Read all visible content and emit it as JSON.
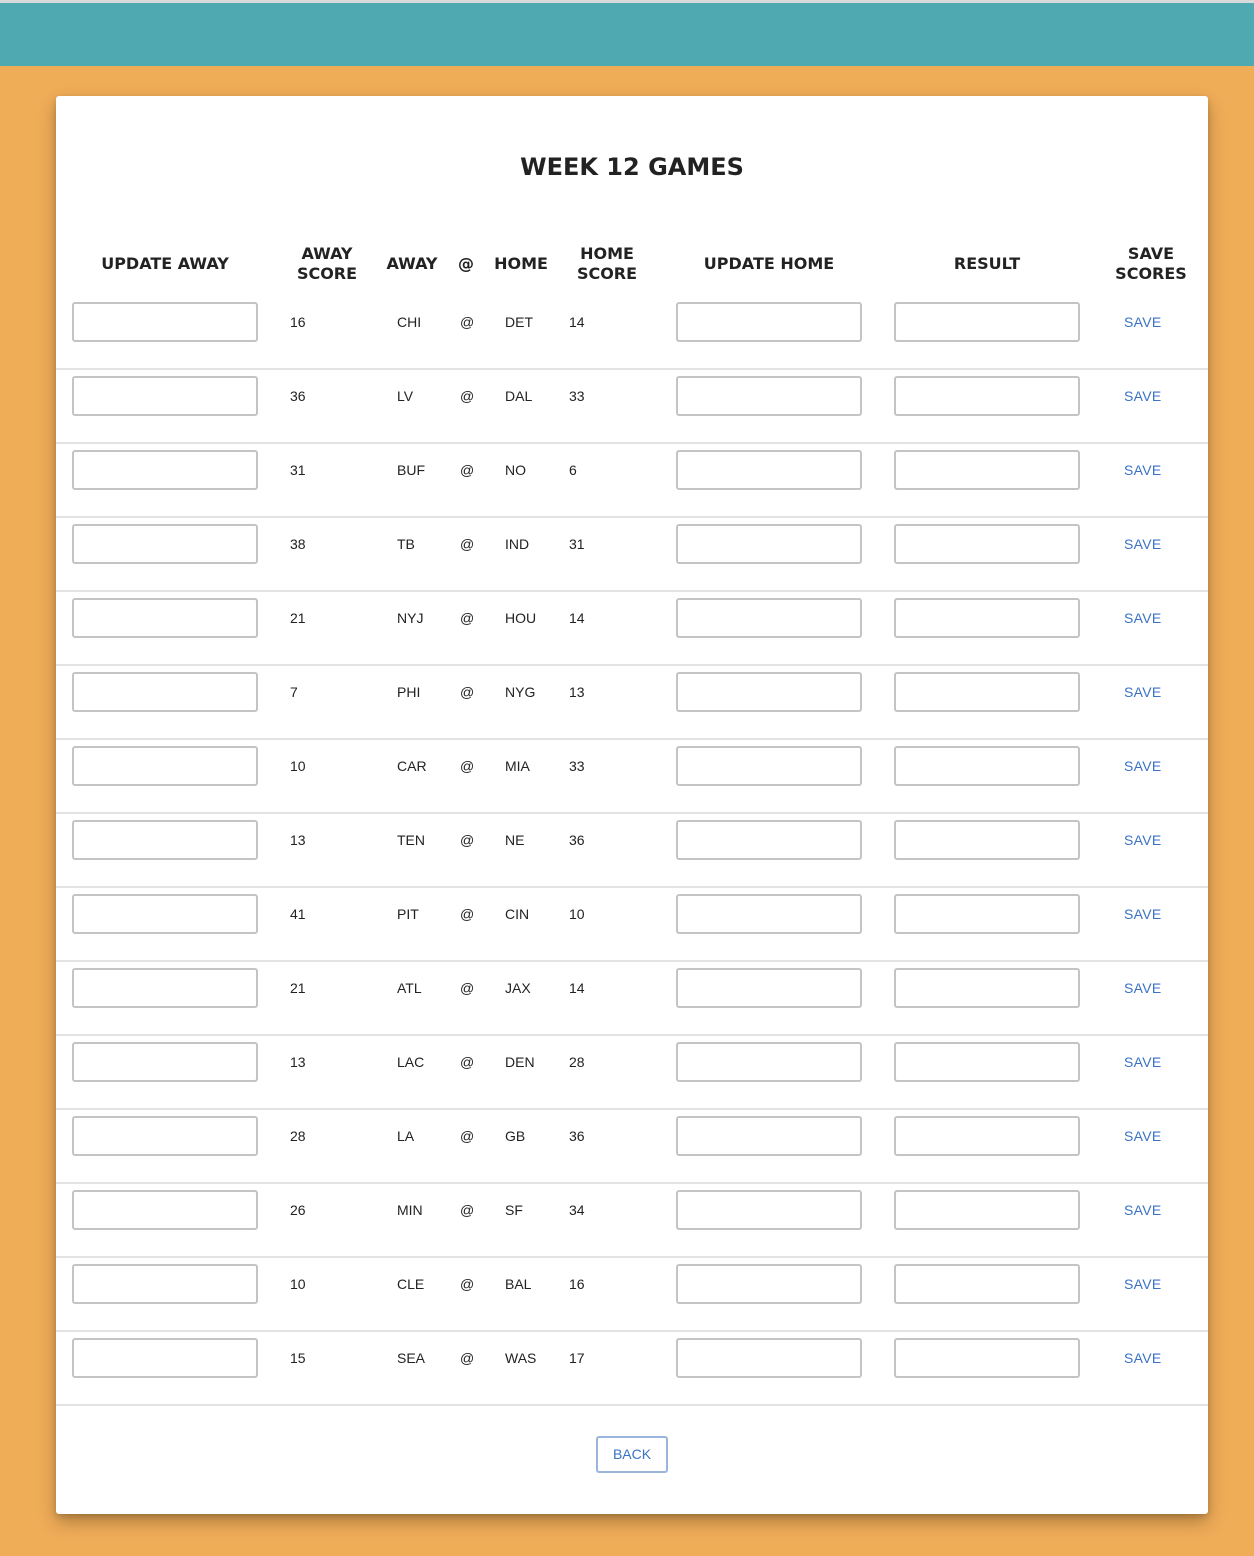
{
  "page": {
    "title": "WEEK 12 GAMES",
    "colors": {
      "header_bar": "#4fa9b0",
      "background": "#f0ad58",
      "card": "#ffffff",
      "link": "#3a72c4"
    }
  },
  "columns": {
    "update_away": "UPDATE AWAY",
    "away_score": "AWAY\nSCORE",
    "away": "AWAY",
    "at": "@",
    "home": "HOME",
    "home_score": "HOME\nSCORE",
    "update_home": "UPDATE HOME",
    "result": "RESULT",
    "save_scores": "SAVE\nSCORES"
  },
  "games": [
    {
      "away_score": "16",
      "away": "CHI",
      "at": "@",
      "home": "DET",
      "home_score": "14",
      "update_away": "",
      "update_home": "",
      "result": "",
      "save_label": "SAVE"
    },
    {
      "away_score": "36",
      "away": "LV",
      "at": "@",
      "home": "DAL",
      "home_score": "33",
      "update_away": "",
      "update_home": "",
      "result": "",
      "save_label": "SAVE"
    },
    {
      "away_score": "31",
      "away": "BUF",
      "at": "@",
      "home": "NO",
      "home_score": "6",
      "update_away": "",
      "update_home": "",
      "result": "",
      "save_label": "SAVE"
    },
    {
      "away_score": "38",
      "away": "TB",
      "at": "@",
      "home": "IND",
      "home_score": "31",
      "update_away": "",
      "update_home": "",
      "result": "",
      "save_label": "SAVE"
    },
    {
      "away_score": "21",
      "away": "NYJ",
      "at": "@",
      "home": "HOU",
      "home_score": "14",
      "update_away": "",
      "update_home": "",
      "result": "",
      "save_label": "SAVE"
    },
    {
      "away_score": "7",
      "away": "PHI",
      "at": "@",
      "home": "NYG",
      "home_score": "13",
      "update_away": "",
      "update_home": "",
      "result": "",
      "save_label": "SAVE"
    },
    {
      "away_score": "10",
      "away": "CAR",
      "at": "@",
      "home": "MIA",
      "home_score": "33",
      "update_away": "",
      "update_home": "",
      "result": "",
      "save_label": "SAVE"
    },
    {
      "away_score": "13",
      "away": "TEN",
      "at": "@",
      "home": "NE",
      "home_score": "36",
      "update_away": "",
      "update_home": "",
      "result": "",
      "save_label": "SAVE"
    },
    {
      "away_score": "41",
      "away": "PIT",
      "at": "@",
      "home": "CIN",
      "home_score": "10",
      "update_away": "",
      "update_home": "",
      "result": "",
      "save_label": "SAVE"
    },
    {
      "away_score": "21",
      "away": "ATL",
      "at": "@",
      "home": "JAX",
      "home_score": "14",
      "update_away": "",
      "update_home": "",
      "result": "",
      "save_label": "SAVE"
    },
    {
      "away_score": "13",
      "away": "LAC",
      "at": "@",
      "home": "DEN",
      "home_score": "28",
      "update_away": "",
      "update_home": "",
      "result": "",
      "save_label": "SAVE"
    },
    {
      "away_score": "28",
      "away": "LA",
      "at": "@",
      "home": "GB",
      "home_score": "36",
      "update_away": "",
      "update_home": "",
      "result": "",
      "save_label": "SAVE"
    },
    {
      "away_score": "26",
      "away": "MIN",
      "at": "@",
      "home": "SF",
      "home_score": "34",
      "update_away": "",
      "update_home": "",
      "result": "",
      "save_label": "SAVE"
    },
    {
      "away_score": "10",
      "away": "CLE",
      "at": "@",
      "home": "BAL",
      "home_score": "16",
      "update_away": "",
      "update_home": "",
      "result": "",
      "save_label": "SAVE"
    },
    {
      "away_score": "15",
      "away": "SEA",
      "at": "@",
      "home": "WAS",
      "home_score": "17",
      "update_away": "",
      "update_home": "",
      "result": "",
      "save_label": "SAVE"
    }
  ],
  "footer": {
    "back_label": "BACK"
  }
}
